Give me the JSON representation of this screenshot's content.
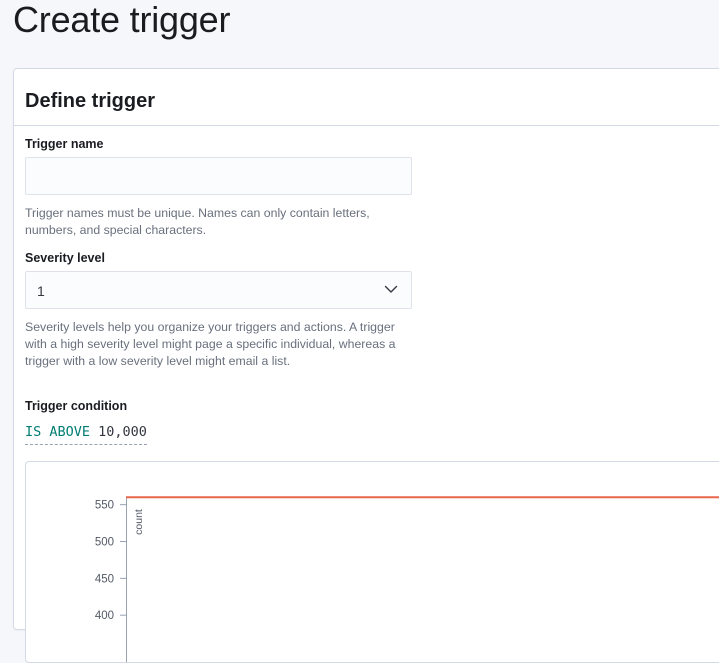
{
  "page": {
    "title": "Create trigger"
  },
  "panel": {
    "title": "Define trigger"
  },
  "form": {
    "trigger_name": {
      "label": "Trigger name",
      "value": "",
      "placeholder": "",
      "help_line1": "Trigger names must be unique. Names can only contain letters,",
      "help_line2": "numbers, and special characters."
    },
    "severity": {
      "label": "Severity level",
      "value": "1",
      "help_line1": "Severity levels help you organize your triggers and actions. A trigger",
      "help_line2": "with a high severity level might page a specific individual, whereas a",
      "help_line3": "trigger with a low severity level might email a list."
    },
    "condition": {
      "label": "Trigger condition",
      "operator": "IS ABOVE",
      "value": "10,000"
    }
  },
  "icons": {
    "severity_dropdown": "chevron-down-icon"
  },
  "colors": {
    "threshold_line": "#e7664c",
    "condition_operator": "#017d73"
  },
  "chart_data": {
    "type": "line",
    "title": "",
    "xlabel": "",
    "ylabel": "count",
    "y_ticks": [
      550,
      500,
      450,
      400
    ],
    "ylim": [
      375,
      565
    ],
    "series": [
      {
        "name": "",
        "type": "threshold",
        "values": [
          560,
          560
        ]
      }
    ],
    "grid": false
  }
}
